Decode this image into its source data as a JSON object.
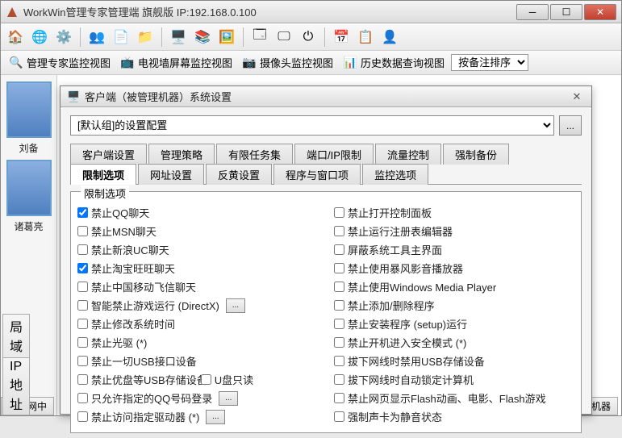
{
  "window": {
    "title": "WorkWin管理专家管理端    旗舰版 IP:192.168.0.100"
  },
  "views": {
    "v1": "管理专家监控视图",
    "v2": "电视墙屏幕监控视图",
    "v3": "摄像头监控视图",
    "v4": "历史数据查询视图",
    "sort_label": "按备注排序"
  },
  "sidebar": {
    "name1": "刘备",
    "name2": "诸葛亮"
  },
  "bottom_tabs": {
    "t1": "局域网中",
    "t2": "IP地址"
  },
  "right_tab": "监视机器",
  "dialog": {
    "title": "客户端（被管理机器）系统设置",
    "config_value": "[默认组]的设置配置",
    "browse": "...",
    "tabs": {
      "r1": [
        "客户端设置",
        "管理策略",
        "有限任务集",
        "端口/IP限制",
        "流量控制",
        "强制备份"
      ],
      "r2": [
        "限制选项",
        "网址设置",
        "反黄设置",
        "程序与窗口项",
        "监控选项"
      ]
    },
    "legend": "限制选项",
    "left_col": [
      {
        "label": "禁止QQ聊天",
        "checked": true
      },
      {
        "label": "禁止MSN聊天",
        "checked": false
      },
      {
        "label": "禁止新浪UC聊天",
        "checked": false
      },
      {
        "label": "禁止淘宝旺旺聊天",
        "checked": true
      },
      {
        "label": "禁止中国移动飞信聊天",
        "checked": false
      },
      {
        "label": "智能禁止游戏运行 (DirectX)",
        "checked": false,
        "ext": true
      },
      {
        "label": "禁止修改系统时间",
        "checked": false
      },
      {
        "label": "禁止光驱 (*)",
        "checked": false
      },
      {
        "label": "禁止一切USB接口设备",
        "checked": false
      },
      {
        "label": "禁止优盘等USB存储设备",
        "checked": false,
        "extra": "U盘只读"
      },
      {
        "label": "只允许指定的QQ号码登录",
        "checked": false,
        "ext": true
      },
      {
        "label": "禁止访问指定驱动器 (*)",
        "checked": false,
        "ext": true
      }
    ],
    "right_col": [
      {
        "label": "禁止打开控制面板",
        "checked": false
      },
      {
        "label": "禁止运行注册表编辑器",
        "checked": false
      },
      {
        "label": "屏蔽系统工具主界面",
        "checked": false
      },
      {
        "label": "禁止使用暴风影音播放器",
        "checked": false
      },
      {
        "label": "禁止使用Windows Media Player",
        "checked": false
      },
      {
        "label": "禁止添加/删除程序",
        "checked": false
      },
      {
        "label": "禁止安装程序 (setup)运行",
        "checked": false
      },
      {
        "label": "禁止开机进入安全模式 (*)",
        "checked": false
      },
      {
        "label": "拔下网线时禁用USB存储设备",
        "checked": false
      },
      {
        "label": "拔下网线时自动锁定计算机",
        "checked": false
      },
      {
        "label": "禁止网页显示Flash动画、电影、Flash游戏",
        "checked": false
      },
      {
        "label": "强制声卡为静音状态",
        "checked": false
      }
    ]
  }
}
